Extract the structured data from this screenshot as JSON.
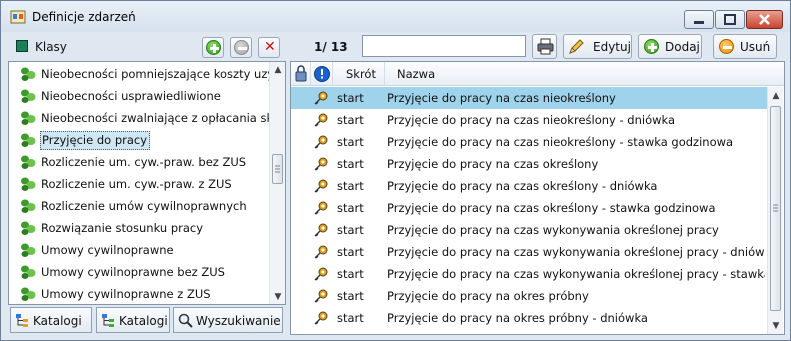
{
  "window": {
    "title": "Definicje zdarzeń"
  },
  "left_toolbar": {
    "label": "Klasy"
  },
  "right_toolbar": {
    "counter": "1/ 13",
    "search_value": "",
    "edit_label": "Edytuj",
    "add_label": "Dodaj",
    "delete_label": "Usuń"
  },
  "classes": [
    "Nieobecności pomniejszające koszty uzysk",
    "Nieobecności usprawiedliwione",
    "Nieobecności zwalniające z opłacania skład",
    "Przyjęcie do pracy",
    "Rozliczenie um. cyw.-praw. bez ZUS",
    "Rozliczenie um. cyw.-praw. z ZUS",
    "Rozliczenie umów cywilnoprawnych",
    "Rozwiązanie stosunku pracy",
    "Umowy cywilnoprawne",
    "Umowy cywilnoprawne bez ZUS",
    "Umowy cywilnoprawne z ZUS"
  ],
  "selected_class_index": 3,
  "bottom_tabs": [
    "Katalogi",
    "Katalogi",
    "Wyszukiwanie"
  ],
  "table": {
    "columns": [
      "Skrót",
      "Nazwa"
    ],
    "rows": [
      {
        "skrot": "start",
        "nazwa": "Przyjęcie do pracy na czas nieokreślony"
      },
      {
        "skrot": "start",
        "nazwa": "Przyjęcie do pracy na czas nieokreślony - dniówka"
      },
      {
        "skrot": "start",
        "nazwa": "Przyjęcie do pracy na czas nieokreślony - stawka godzinowa"
      },
      {
        "skrot": "start",
        "nazwa": "Przyjęcie do pracy na czas określony"
      },
      {
        "skrot": "start",
        "nazwa": "Przyjęcie do pracy na czas określony - dniówka"
      },
      {
        "skrot": "start",
        "nazwa": "Przyjęcie do pracy na czas określony - stawka godzinowa"
      },
      {
        "skrot": "start",
        "nazwa": "Przyjęcie do pracy na czas wykonywania określonej pracy"
      },
      {
        "skrot": "start",
        "nazwa": "Przyjęcie do pracy na czas wykonywania określonej pracy - dniówka"
      },
      {
        "skrot": "start",
        "nazwa": "Przyjęcie do pracy na czas wykonywania określonej pracy - stawka go..."
      },
      {
        "skrot": "start",
        "nazwa": "Przyjęcie do pracy na okres próbny"
      },
      {
        "skrot": "start",
        "nazwa": "Przyjęcie do pracy na okres próbny - dniówka"
      }
    ],
    "selected_row_index": 0
  },
  "colors": {
    "selection": "#9fd3ec",
    "accent_green": "#2f9a1d",
    "close_red": "#c8452f"
  }
}
